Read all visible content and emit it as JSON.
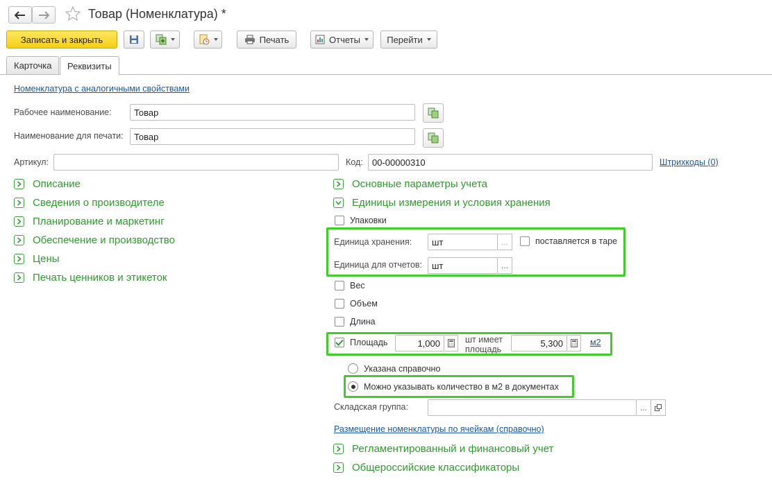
{
  "window": {
    "title": "Товар (Номенклатура) *"
  },
  "toolbar": {
    "save_close_label": "Записать и закрыть",
    "print_label": "Печать",
    "reports_label": "Отчеты",
    "goto_label": "Перейти"
  },
  "tabs": [
    {
      "label": "Карточка",
      "active": false
    },
    {
      "label": "Реквизиты",
      "active": true
    }
  ],
  "form": {
    "similar_link": "Номенклатура с аналогичными свойствами",
    "working_name_label": "Рабочее наименование:",
    "working_name_value": "Товар",
    "print_name_label": "Наименование для печати:",
    "print_name_value": "Товар",
    "article_label": "Артикул:",
    "article_value": "",
    "code_label": "Код:",
    "code_value": "00-00000310",
    "barcodes_link": "Штрихкоды (0)"
  },
  "left_groups": [
    "Описание",
    "Сведения о производителе",
    "Планирование и маркетинг",
    "Обеспечение и производство",
    "Цены",
    "Печать ценников и этикеток"
  ],
  "right": {
    "main_params_group": "Основные параметры учета",
    "units_group": "Единицы измерения и условия хранения",
    "packages_label": "Упаковки",
    "storage_unit_label": "Единица хранения:",
    "storage_unit_value": "шт",
    "tara_label": "поставляется в таре",
    "report_unit_label": "Единица для отчетов:",
    "report_unit_value": "шт",
    "weight_label": "Вес",
    "volume_label": "Объем",
    "length_label": "Длина",
    "area_label": "Площадь",
    "area_qty": "1,000",
    "area_has_label": "шт имеет площадь",
    "area_value": "5,300",
    "area_unit_link": "м2",
    "radio_reference": "Указана справочно",
    "radio_documents": "Можно указывать количество в м2 в документах",
    "radio_selected": "documents",
    "warehouse_group_label": "Складская группа:",
    "warehouse_group_value": "",
    "cells_link": "Размещение номенклатуры по ячейкам (справочно)",
    "regulated_group": "Регламентированный и финансовый учет",
    "classifiers_group": "Общероссийские классификаторы"
  },
  "colors": {
    "accent_green": "#2e9a2e",
    "highlight": "#3ecf26",
    "primary_button": "#f5cf14",
    "link": "#1a57a8"
  }
}
